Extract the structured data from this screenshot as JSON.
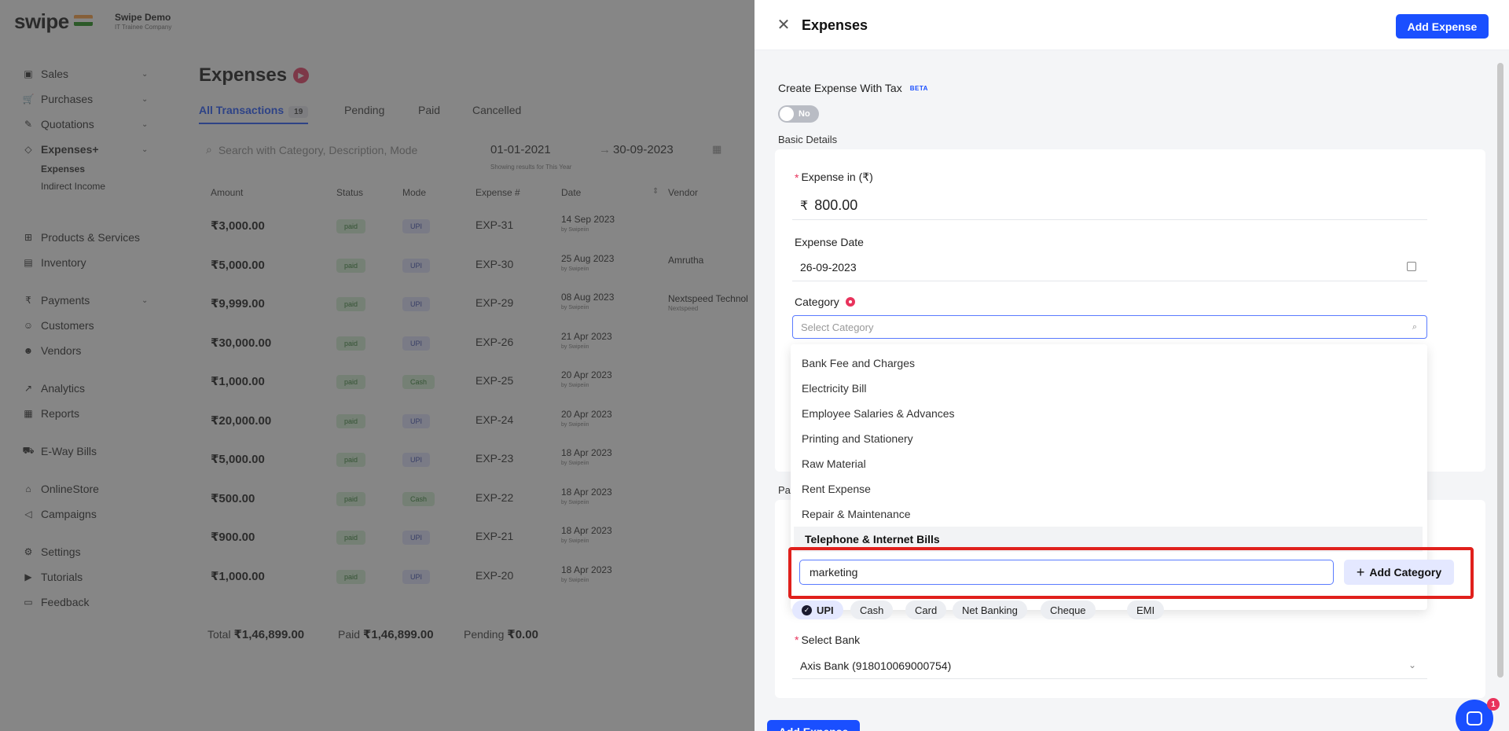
{
  "app": {
    "logo": "swipe",
    "company_name": "Swipe Demo",
    "company_sub": "IT Trainee Company"
  },
  "sidebar": {
    "items": [
      {
        "label": "Sales",
        "icon": "sales-icon",
        "glyph": "▣",
        "caret": true
      },
      {
        "label": "Purchases",
        "icon": "cart-icon",
        "glyph": "🛒",
        "caret": true
      },
      {
        "label": "Quotations",
        "icon": "pen-icon",
        "glyph": "✎",
        "caret": true
      },
      {
        "label": "Expenses+",
        "icon": "tag-icon",
        "glyph": "◇",
        "caret": true
      },
      {
        "label": "Products & Services",
        "icon": "products-icon",
        "glyph": "⊞",
        "caret": false
      },
      {
        "label": "Inventory",
        "icon": "inventory-icon",
        "glyph": "▤",
        "caret": false
      },
      {
        "label": "Payments",
        "icon": "rupee-icon",
        "glyph": "₹",
        "caret": true
      },
      {
        "label": "Customers",
        "icon": "user-icon",
        "glyph": "☺",
        "caret": false
      },
      {
        "label": "Vendors",
        "icon": "users-icon",
        "glyph": "☻",
        "caret": false
      },
      {
        "label": "Analytics",
        "icon": "analytics-icon",
        "glyph": "↗",
        "caret": false
      },
      {
        "label": "Reports",
        "icon": "reports-icon",
        "glyph": "▦",
        "caret": false
      },
      {
        "label": "E-Way Bills",
        "icon": "truck-icon",
        "glyph": "⛟",
        "caret": false
      },
      {
        "label": "OnlineStore",
        "icon": "store-icon",
        "glyph": "⌂",
        "caret": false
      },
      {
        "label": "Campaigns",
        "icon": "megaphone-icon",
        "glyph": "◁",
        "caret": false
      },
      {
        "label": "Settings",
        "icon": "gear-icon",
        "glyph": "⚙",
        "caret": false
      },
      {
        "label": "Tutorials",
        "icon": "youtube-icon",
        "glyph": "▶",
        "caret": false
      },
      {
        "label": "Feedback",
        "icon": "feedback-icon",
        "glyph": "▭",
        "caret": false
      }
    ],
    "sub_items": [
      "Expenses",
      "Indirect Income"
    ]
  },
  "main": {
    "title": "Expenses",
    "tabs": [
      {
        "label": "All Transactions",
        "badge": "19"
      },
      {
        "label": "Pending"
      },
      {
        "label": "Paid"
      },
      {
        "label": "Cancelled"
      }
    ],
    "search_placeholder": "Search with Category, Description, Mode",
    "date_from": "01-01-2021",
    "date_to": "30-09-2023",
    "date_hint": "Showing results for This Year",
    "columns": [
      "Amount",
      "Status",
      "Mode",
      "Expense #",
      "Date",
      "Vendor"
    ],
    "rows": [
      {
        "amount": "₹3,000.00",
        "status": "paid",
        "mode": "UPI",
        "exp": "EXP-31",
        "date": "14 Sep 2023",
        "by": "by Swipeiin",
        "vendor": "",
        "vendor_sub": ""
      },
      {
        "amount": "₹5,000.00",
        "status": "paid",
        "mode": "UPI",
        "exp": "EXP-30",
        "date": "25 Aug 2023",
        "by": "by Swipeiin",
        "vendor": "Amrutha",
        "vendor_sub": ""
      },
      {
        "amount": "₹9,999.00",
        "status": "paid",
        "mode": "UPI",
        "exp": "EXP-29",
        "date": "08 Aug 2023",
        "by": "by Swipeiin",
        "vendor": "Nextspeed Technol",
        "vendor_sub": "Nextspeed"
      },
      {
        "amount": "₹30,000.00",
        "status": "paid",
        "mode": "UPI",
        "exp": "EXP-26",
        "date": "21 Apr 2023",
        "by": "by Swipeiin",
        "vendor": "",
        "vendor_sub": ""
      },
      {
        "amount": "₹1,000.00",
        "status": "paid",
        "mode": "Cash",
        "exp": "EXP-25",
        "date": "20 Apr 2023",
        "by": "by Swipeiin",
        "vendor": "",
        "vendor_sub": ""
      },
      {
        "amount": "₹20,000.00",
        "status": "paid",
        "mode": "UPI",
        "exp": "EXP-24",
        "date": "20 Apr 2023",
        "by": "by Swipeiin",
        "vendor": "",
        "vendor_sub": ""
      },
      {
        "amount": "₹5,000.00",
        "status": "paid",
        "mode": "UPI",
        "exp": "EXP-23",
        "date": "18 Apr 2023",
        "by": "by Swipeiin",
        "vendor": "",
        "vendor_sub": ""
      },
      {
        "amount": "₹500.00",
        "status": "paid",
        "mode": "Cash",
        "exp": "EXP-22",
        "date": "18 Apr 2023",
        "by": "by Swipeiin",
        "vendor": "",
        "vendor_sub": ""
      },
      {
        "amount": "₹900.00",
        "status": "paid",
        "mode": "UPI",
        "exp": "EXP-21",
        "date": "18 Apr 2023",
        "by": "by Swipeiin",
        "vendor": "",
        "vendor_sub": ""
      },
      {
        "amount": "₹1,000.00",
        "status": "paid",
        "mode": "UPI",
        "exp": "EXP-20",
        "date": "18 Apr 2023",
        "by": "by Swipeiin",
        "vendor": "",
        "vendor_sub": ""
      }
    ],
    "totals": {
      "total_label": "Total",
      "total_value": "₹1,46,899.00",
      "paid_label": "Paid",
      "paid_value": "₹1,46,899.00",
      "pending_label": "Pending",
      "pending_value": "₹0.00"
    }
  },
  "drawer": {
    "title": "Expenses",
    "add_expense_label": "Add Expense",
    "tax_label": "Create Expense With Tax",
    "beta_label": "BETA",
    "toggle_label": "No",
    "basic_details_label": "Basic Details",
    "expense_label": "Expense in (₹)",
    "expense_currency": "₹",
    "expense_value": "800.00",
    "date_label": "Expense Date",
    "date_value": "26-09-2023",
    "category_label": "Category",
    "category_placeholder": "Select Category",
    "categories": [
      "Bank Fee and Charges",
      "Electricity Bill",
      "Employee Salaries & Advances",
      "Printing and Stationery",
      "Raw Material",
      "Rent Expense",
      "Repair & Maintenance",
      "Telephone & Internet Bills"
    ],
    "hovered_category": "Telephone & Internet Bills",
    "payment_label": "Pa",
    "new_category_value": "marketing",
    "add_category_label": "Add Category",
    "payment_modes": [
      "UPI",
      "Cash",
      "Card",
      "Net Banking",
      "Cheque",
      "EMI"
    ],
    "selected_mode": "UPI",
    "bank_label": "Select Bank",
    "bank_value": "Axis Bank (918010069000754)",
    "chat_badge": "1"
  },
  "colors": {
    "primary": "#1a4fff",
    "accent_red": "#e8335c",
    "highlight": "#e0201c"
  }
}
